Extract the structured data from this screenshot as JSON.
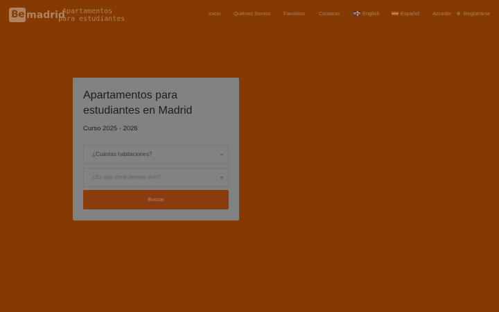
{
  "header": {
    "logo": {
      "box_text": "Be",
      "rest_text": "madrid"
    },
    "tagline": {
      "line1": "Apartamentos",
      "line2": "para estudiantes"
    },
    "nav": {
      "inicio": "Inicio",
      "quienes": "Quiénes Somos",
      "favoritos": "Favoritos",
      "contacto": "Contacto",
      "english": "English",
      "espanol": "Español",
      "acceder": "Acceder",
      "registrarse": "Registrarse"
    }
  },
  "search_card": {
    "title": "Apartamentos para estudiantes en Madrid",
    "subtitle": "Curso 2025 - 2026",
    "rooms_select": {
      "placeholder": "¿Cuántas habitaciones?"
    },
    "zone_select": {
      "placeholder": "¿En que zona deseas vivir?"
    },
    "submit_label": "Buscar"
  },
  "colors": {
    "background": "#843a00",
    "card": "#828282",
    "button": "#8a3c0e",
    "nav_text": "#b0825f"
  },
  "icons": [
    "uk-flag-icon",
    "spain-flag-icon",
    "user-icon",
    "chevron-down-icon"
  ]
}
